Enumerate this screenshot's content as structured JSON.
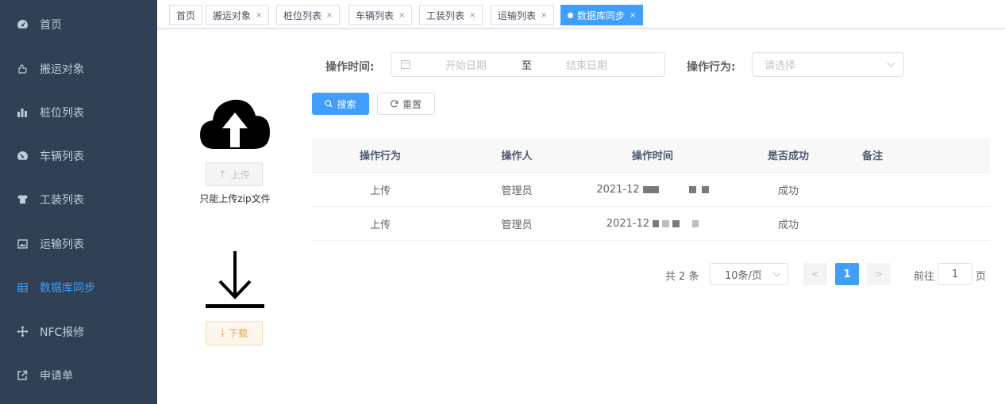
{
  "sidebar": {
    "items": [
      {
        "label": "首页",
        "icon": "dashboard-icon"
      },
      {
        "label": "搬运对象",
        "icon": "hand-icon"
      },
      {
        "label": "桩位列表",
        "icon": "bar-chart-icon"
      },
      {
        "label": "车辆列表",
        "icon": "gauge-icon"
      },
      {
        "label": "工装列表",
        "icon": "shirt-icon"
      },
      {
        "label": "运输列表",
        "icon": "image-icon"
      },
      {
        "label": "数据库同步",
        "icon": "grid-icon",
        "active": true
      },
      {
        "label": "NFC报修",
        "icon": "move-icon"
      },
      {
        "label": "申请单",
        "icon": "external-link-icon"
      }
    ],
    "bg_color": "#304156",
    "active_color": "#409eff"
  },
  "tags": [
    {
      "label": "首页",
      "closable": false
    },
    {
      "label": "搬运对象",
      "closable": true
    },
    {
      "label": "桩位列表",
      "closable": true
    },
    {
      "label": "车辆列表",
      "closable": true
    },
    {
      "label": "工装列表",
      "closable": true
    },
    {
      "label": "运输列表",
      "closable": true
    },
    {
      "label": "数据库同步",
      "closable": true,
      "active": true
    }
  ],
  "upload": {
    "button_label": "上传",
    "tip": "只能上传zip文件"
  },
  "download": {
    "button_label": "下载"
  },
  "filter": {
    "time_label": "操作时间:",
    "start_placeholder": "开始日期",
    "range_separator": "至",
    "end_placeholder": "结束日期",
    "action_label": "操作行为:",
    "action_placeholder": "请选择",
    "search_label": "搜索",
    "reset_label": "重置"
  },
  "table": {
    "headers": [
      "操作行为",
      "操作人",
      "操作时间",
      "是否成功",
      "备注"
    ],
    "rows": [
      {
        "action": "上传",
        "operator": "管理员",
        "time": "2021-12",
        "success": "成功",
        "remark": ""
      },
      {
        "action": "上传",
        "operator": "管理员",
        "time": "2021-12",
        "success": "成功",
        "remark": ""
      }
    ]
  },
  "pagination": {
    "total_text": "共 2 条",
    "page_size": "10条/页",
    "current_page": "1",
    "goto_label": "前往",
    "goto_value": "1",
    "page_suffix": "页"
  }
}
